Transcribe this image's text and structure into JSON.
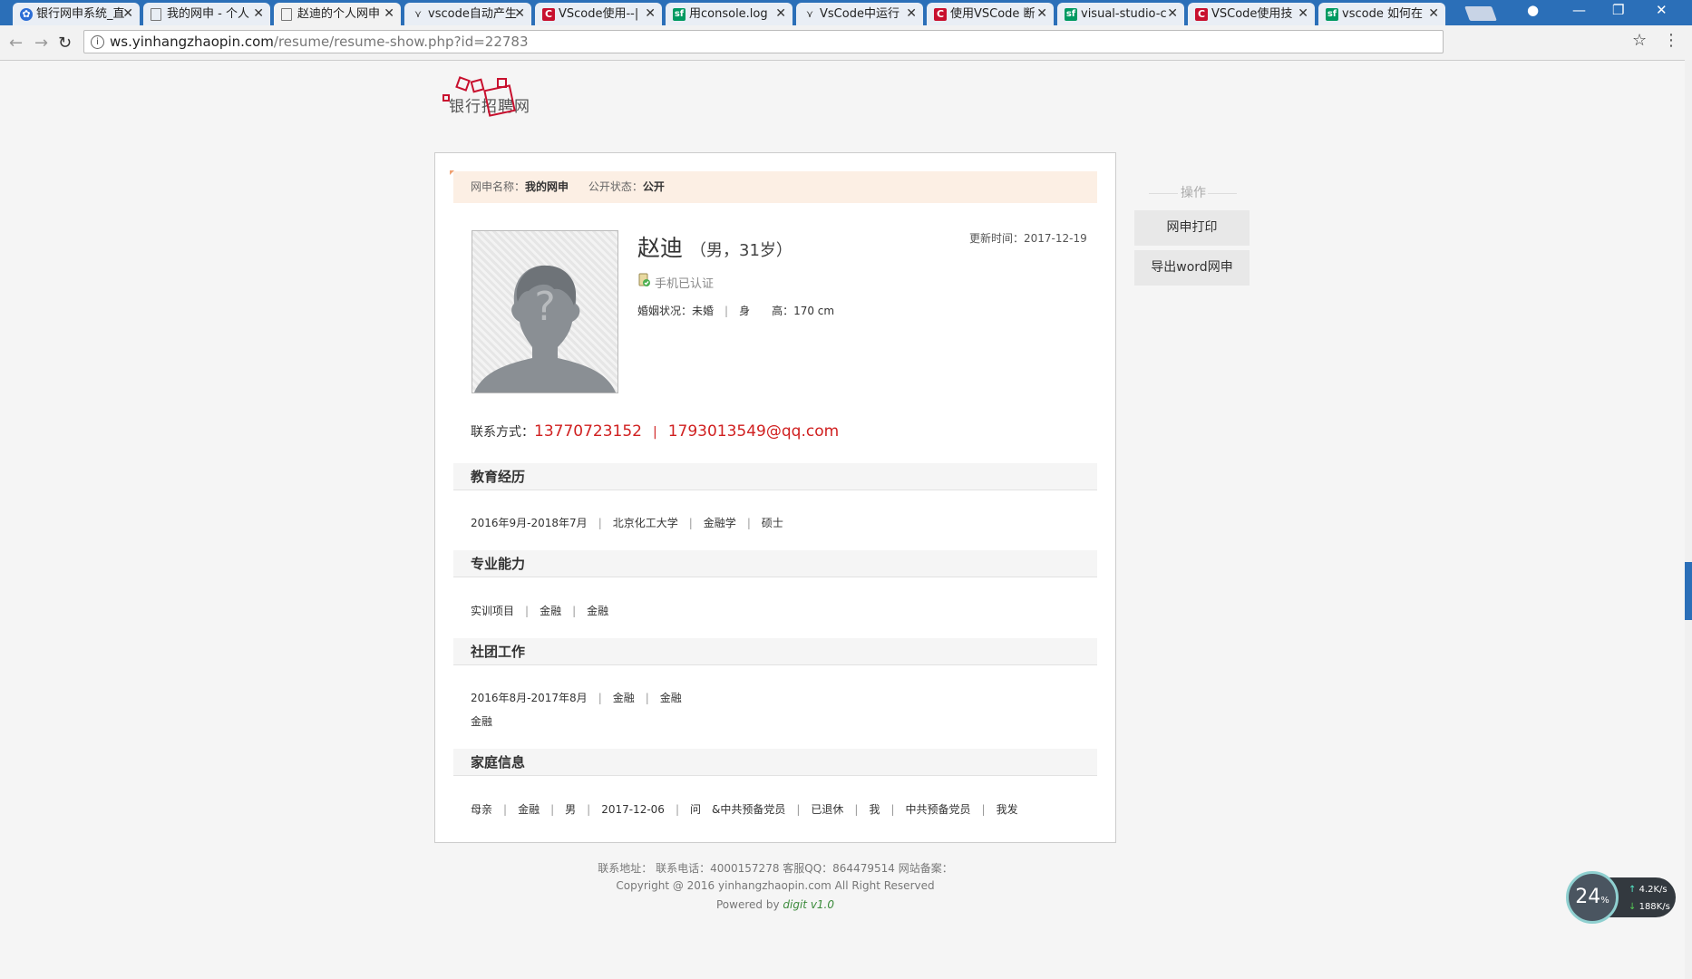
{
  "browser": {
    "tabs": [
      {
        "title": "银行网申系统_直",
        "icon": "paw-icon"
      },
      {
        "title": "我的网申 - 个人",
        "icon": "doc-icon"
      },
      {
        "title": "赵迪的个人网申",
        "icon": "doc-icon",
        "active": true
      },
      {
        "title": "vscode自动产生",
        "icon": "vs-icon"
      },
      {
        "title": "VScode使用--|",
        "icon": "c-icon"
      },
      {
        "title": "用console.log",
        "icon": "sf-icon"
      },
      {
        "title": "VsCode中运行",
        "icon": "vs-icon"
      },
      {
        "title": "使用VSCode 断",
        "icon": "c-icon"
      },
      {
        "title": "visual-studio-c",
        "icon": "sf-icon"
      },
      {
        "title": "VSCode使用技",
        "icon": "c-icon"
      },
      {
        "title": "vscode 如何在",
        "icon": "sf-icon"
      }
    ],
    "url_host": "ws.yinhangzhaopin.com",
    "url_path": "/resume/resume-show.php?id=22783"
  },
  "logo": {
    "text": "银行招聘网",
    "char": "招"
  },
  "notice": {
    "name_label": "网申名称：",
    "name_value": "我的网申",
    "status_label": "公开状态：",
    "status_value": "公开"
  },
  "profile": {
    "name": "赵迪",
    "meta": "（男，31岁）",
    "updated": "更新时间：2017-12-19",
    "verified": "手机已认证",
    "marital": "婚姻状况：未婚",
    "height_label": "身　　高：",
    "height_value": "170 cm"
  },
  "contact": {
    "label": "联系方式：",
    "phone": "13770723152",
    "email": "1793013549@qq.com"
  },
  "sections": {
    "education": {
      "title": "教育经历",
      "items": [
        "2016年9月-2018年7月",
        "北京化工大学",
        "金融学",
        "硕士"
      ]
    },
    "skills": {
      "title": "专业能力",
      "items": [
        "实训项目",
        "金融",
        "金融"
      ]
    },
    "club": {
      "title": "社团工作",
      "items": [
        "2016年8月-2017年8月",
        "金融",
        "金融"
      ],
      "desc": "金融"
    },
    "family": {
      "title": "家庭信息",
      "items": [
        "母亲",
        "金融",
        "男",
        "2017-12-06",
        "问　&中共预备党员",
        "已退休",
        "我",
        "中共预备党员",
        "我发"
      ]
    }
  },
  "ops": {
    "title": "操作",
    "print": "网申打印",
    "export": "导出word网申"
  },
  "footer": {
    "line1": "联系地址：  联系电话：4000157278 客服QQ：864479514 网站备案：",
    "line2": "Copyright @ 2016 yinhangzhaopin.com All Right Reserved",
    "powered": "Powered by",
    "powered_link": "digit v1.0"
  },
  "net_widget": {
    "percent": "24",
    "unit": "%",
    "up": "4.2K/s",
    "down": "188K/s"
  },
  "colors": {
    "accent_red": "#d02020",
    "notice_bg": "#fcefe4",
    "tabbar": "#2b6fb8"
  }
}
